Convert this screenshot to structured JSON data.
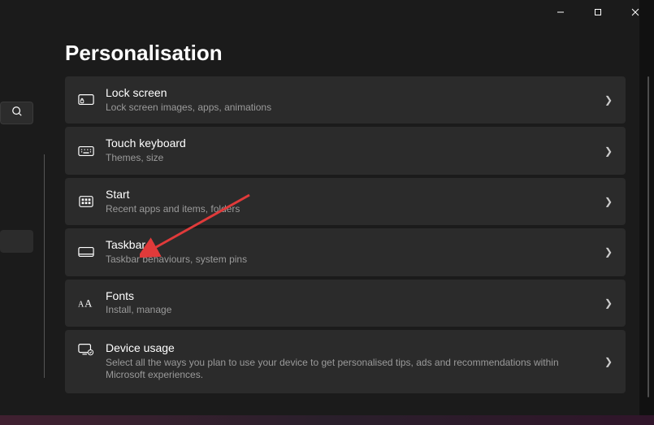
{
  "page": {
    "title": "Personalisation"
  },
  "items": [
    {
      "title": "Lock screen",
      "desc": "Lock screen images, apps, animations"
    },
    {
      "title": "Touch keyboard",
      "desc": "Themes, size"
    },
    {
      "title": "Start",
      "desc": "Recent apps and items, folders"
    },
    {
      "title": "Taskbar",
      "desc": "Taskbar behaviours, system pins"
    },
    {
      "title": "Fonts",
      "desc": "Install, manage"
    },
    {
      "title": "Device usage",
      "desc": "Select all the ways you plan to use your device to get personalised tips, ads and recommendations within Microsoft experiences."
    }
  ]
}
